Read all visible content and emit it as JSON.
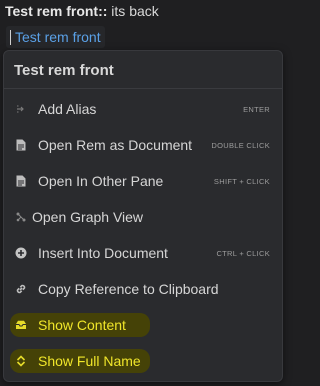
{
  "rem": {
    "front": "Test rem front",
    "separator": "::",
    "back": " its back"
  },
  "editor": {
    "text": "Test rem front"
  },
  "menu": {
    "title": "Test rem front",
    "items": [
      {
        "label": "Add Alias",
        "shortcut": "ENTER",
        "icon": "arrow-icon"
      },
      {
        "label": "Open Rem as Document",
        "shortcut": "DOUBLE CLICK",
        "icon": "document-icon"
      },
      {
        "label": "Open In Other Pane",
        "shortcut": "SHIFT + CLICK",
        "icon": "document-icon"
      },
      {
        "label": "Open Graph View",
        "shortcut": "",
        "icon": "graph-icon"
      },
      {
        "label": "Insert Into Document",
        "shortcut": "CTRL + CLICK",
        "icon": "plus-circle-icon"
      },
      {
        "label": "Copy Reference to Clipboard",
        "shortcut": "",
        "icon": "link-icon"
      },
      {
        "label": "Show Content",
        "shortcut": "",
        "icon": "inbox-icon"
      },
      {
        "label": "Show Full Name",
        "shortcut": "",
        "icon": "expand-icon"
      }
    ]
  },
  "colors": {
    "background": "#1f1f21",
    "menu_background": "#2a2b2e",
    "link_blue": "#5aa0e6",
    "highlight_text": "#f0e62a",
    "highlight_bg": "#4a4600"
  }
}
